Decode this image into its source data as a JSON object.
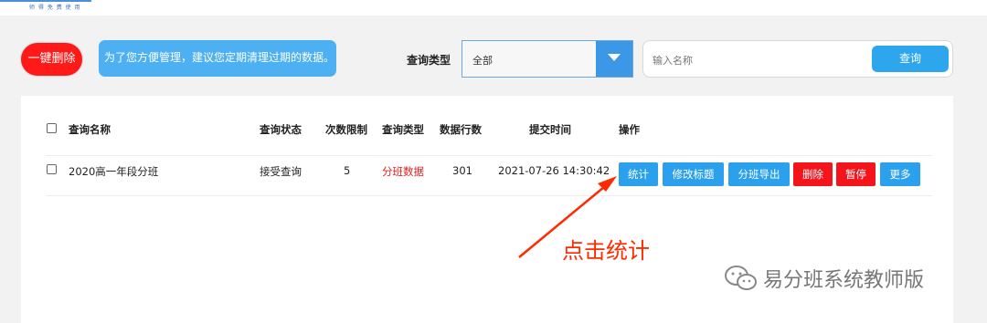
{
  "header": {
    "logo_subtitle": "师 得 免 费 使 用"
  },
  "toolbar": {
    "one_click_delete": "一键删除",
    "notice": "为了您方便管理，建议您定期清理过期的数据。",
    "query_type_label": "查询类型",
    "query_type_value": "全部",
    "search_placeholder": "输入名称",
    "search_button": "查询"
  },
  "table": {
    "columns": [
      "查询名称",
      "查询状态",
      "次数限制",
      "查询类型",
      "数据行数",
      "提交时间",
      "操作"
    ],
    "rows": [
      {
        "name": "2020高一年段分班",
        "status": "接受查询",
        "limit": "5",
        "type": "分班数据",
        "rows": "301",
        "time": "2021-07-26 14:30:42",
        "actions": [
          "统计",
          "修改标题",
          "分班导出",
          "删除",
          "暂停",
          "更多"
        ]
      }
    ]
  },
  "annotation": "点击统计",
  "watermark": "易分班系统教师版",
  "colors": {
    "accent": "#2ba0ec",
    "danger": "#f4141c",
    "annotation": "#ff2a00"
  }
}
